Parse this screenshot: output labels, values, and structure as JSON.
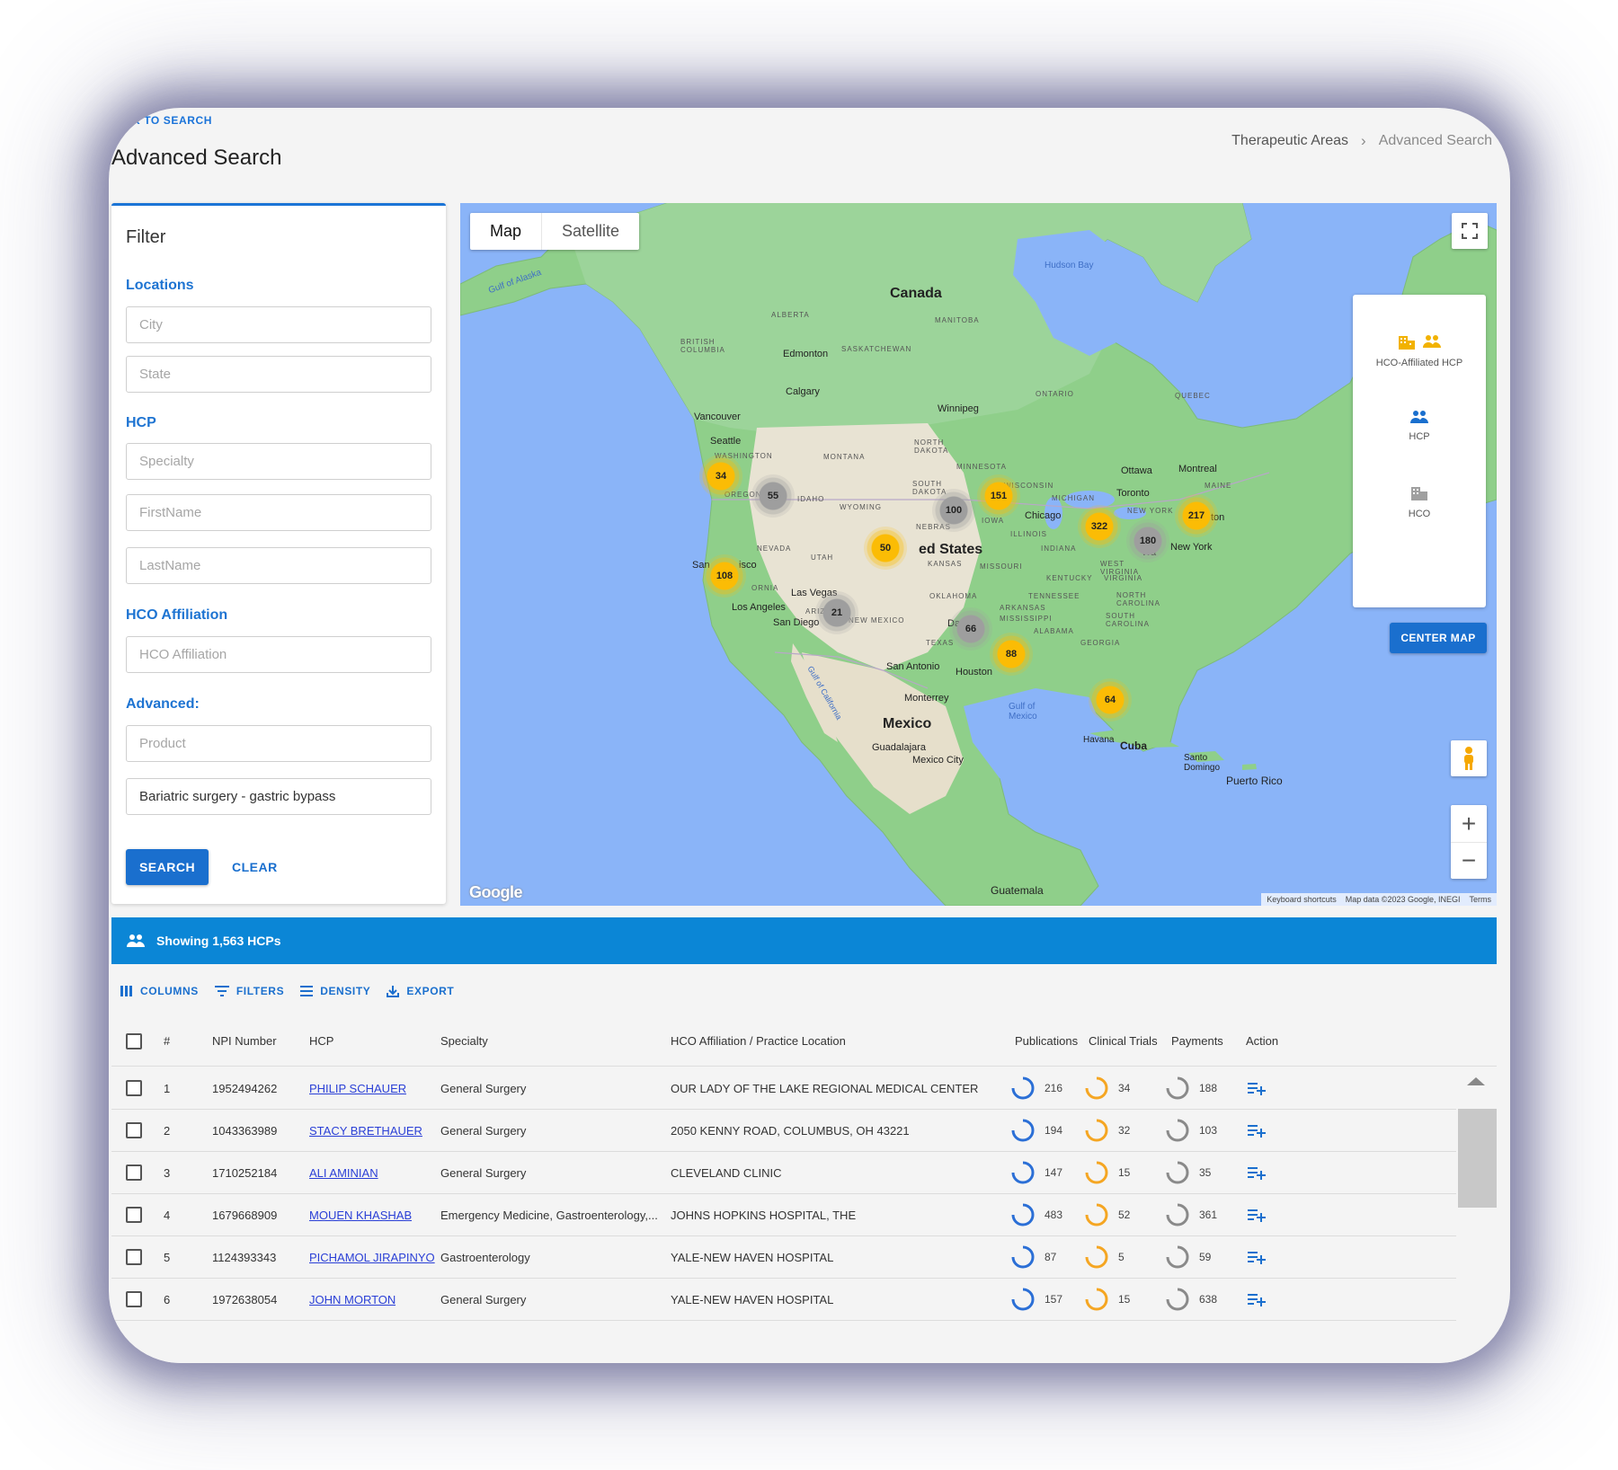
{
  "header": {
    "back_link": "K TO SEARCH",
    "title": "Advanced Search",
    "breadcrumb": [
      "Therapeutic Areas",
      "Advanced Search"
    ]
  },
  "filter": {
    "title": "Filter",
    "sections": {
      "locations": "Locations",
      "hcp": "HCP",
      "hco_affiliation": "HCO Affiliation",
      "advanced": "Advanced:"
    },
    "placeholders": {
      "city": "City",
      "state": "State",
      "specialty": "Specialty",
      "first_name": "FirstName",
      "last_name": "LastName",
      "hco_affiliation": "HCO Affiliation",
      "product": "Product"
    },
    "values": {
      "procedure": "Bariatric surgery - gastric bypass"
    },
    "search_label": "SEARCH",
    "clear_label": "CLEAR"
  },
  "map": {
    "tabs": [
      "Map",
      "Satellite"
    ],
    "legend": {
      "hco_affiliated_hcp": "HCO-Affiliated HCP",
      "hcp": "HCP",
      "hco": "HCO"
    },
    "center_map_label": "CENTER MAP",
    "credits": [
      "Keyboard shortcuts",
      "Map data ©2023 Google, INEGI",
      "Terms"
    ],
    "google_logo": "Google",
    "labels": {
      "canada": "Canada",
      "united_states": "ed States",
      "mexico": "Mexico",
      "cuba": "Cuba",
      "havana": "Havana",
      "guatemala": "Guatemala",
      "puerto_rico": "Puerto Rico",
      "santo_domingo": "Santo Domingo",
      "hudson_bay": "Hudson Bay",
      "gulf_of_alaska": "Gulf of Alaska",
      "gulf_of_mexico": "Gulf of Mexico",
      "gulf_of_california": "Gulf of California",
      "alberta": "ALBERTA",
      "manitoba": "MANITOBA",
      "british_columbia": "BRITISH COLUMBIA",
      "saskatchewan": "SASKATCHEWAN",
      "ontario": "ONTARIO",
      "quebec": "QUEBEC",
      "edmonton": "Edmonton",
      "calgary": "Calgary",
      "winnipeg": "Winnipeg",
      "vancouver": "Vancouver",
      "seattle": "Seattle",
      "washington": "WASHINGTON",
      "oregon": "OREGON",
      "idaho": "IDAHO",
      "montana": "MONTANA",
      "wyoming": "WYOMING",
      "north_dakota": "NORTH DAKOTA",
      "south_dakota": "SOUTH DAKOTA",
      "minnesota": "MINNESOTA",
      "wisconsin": "WISCONSIN",
      "michigan": "MICHIGAN",
      "iowa": "IOWA",
      "nebraska": "NEBRAS",
      "nevada": "NEVADA",
      "utah": "UTAH",
      "kansas": "KANSAS",
      "missouri": "MISSOURI",
      "illinois": "ILLINOIS",
      "indiana": "INDIANA",
      "kentucky": "KENTUCKY",
      "tennessee": "TENNESSEE",
      "oklahoma": "OKLAHOMA",
      "texas": "TEXAS",
      "arkansas": "ARKANSAS",
      "mississippi": "MISSISSIPPI",
      "alabama": "ALABAMA",
      "georgia": "GEORGIA",
      "new_mexico": "NEW MEXICO",
      "arizona": "ARIZ",
      "california": "ORNIA",
      "west_virginia": "WEST VIRGINIA",
      "virginia": "VIRGINIA",
      "north_carolina": "NORTH CAROLINA",
      "south_carolina": "SOUTH CAROLINA",
      "new_york_state": "NEW YORK",
      "maine": "MAINE",
      "ottawa": "Ottawa",
      "montreal": "Montreal",
      "toronto": "Toronto",
      "chicago": "Chicago",
      "new_york": "New York",
      "los_angeles": "Los Angeles",
      "san_diego": "San Diego",
      "las_vegas": "Las Vegas",
      "san_francisco": "San",
      "san_francisco_rest": "isco",
      "dallas": "Da",
      "houston": "Houston",
      "san_antonio": "San Antonio",
      "monterrey": "Monterrey",
      "guadalajara": "Guadalajara",
      "mexico_city": "Mexico City",
      "washington_dc": "Wa",
      "boston": "ton"
    },
    "clusters": [
      {
        "label": "34",
        "type": "yellow"
      },
      {
        "label": "55",
        "type": "gray"
      },
      {
        "label": "100",
        "type": "gray"
      },
      {
        "label": "151",
        "type": "yellow"
      },
      {
        "label": "322",
        "type": "yellow"
      },
      {
        "label": "180",
        "type": "gray"
      },
      {
        "label": "217",
        "type": "yellow"
      },
      {
        "label": "50",
        "type": "yellow"
      },
      {
        "label": "108",
        "type": "yellow"
      },
      {
        "label": "21",
        "type": "gray"
      },
      {
        "label": "66",
        "type": "gray"
      },
      {
        "label": "88",
        "type": "yellow"
      },
      {
        "label": "64",
        "type": "yellow"
      }
    ]
  },
  "results": {
    "showing_text": "Showing 1,563 HCPs"
  },
  "grid": {
    "toolbar": [
      "COLUMNS",
      "FILTERS",
      "DENSITY",
      "EXPORT"
    ],
    "columns": [
      "#",
      "NPI Number",
      "HCP",
      "Specialty",
      "HCO Affiliation / Practice Location",
      "Publications",
      "Clinical Trials",
      "Payments",
      "Action"
    ],
    "rows": [
      {
        "idx": "1",
        "npi": "1952494262",
        "hcp": "PHILIP SCHAUER",
        "specialty": "General Surgery",
        "hco": "OUR LADY OF THE LAKE REGIONAL MEDICAL CENTER",
        "publications": "216",
        "trials": "34",
        "payments": "188"
      },
      {
        "idx": "2",
        "npi": "1043363989",
        "hcp": "STACY BRETHAUER",
        "specialty": "General Surgery",
        "hco": "2050 KENNY ROAD, COLUMBUS, OH 43221",
        "publications": "194",
        "trials": "32",
        "payments": "103"
      },
      {
        "idx": "3",
        "npi": "1710252184",
        "hcp": "ALI AMINIAN",
        "specialty": "General Surgery",
        "hco": "CLEVELAND CLINIC",
        "publications": "147",
        "trials": "15",
        "payments": "35"
      },
      {
        "idx": "4",
        "npi": "1679668909",
        "hcp": "MOUEN KHASHAB",
        "specialty": "Emergency Medicine, Gastroenterology,...",
        "hco": "JOHNS HOPKINS HOSPITAL, THE",
        "publications": "483",
        "trials": "52",
        "payments": "361"
      },
      {
        "idx": "5",
        "npi": "1124393343",
        "hcp": "PICHAMOL JIRAPINYO",
        "specialty": "Gastroenterology",
        "hco": "YALE-NEW HAVEN HOSPITAL",
        "publications": "87",
        "trials": "5",
        "payments": "59"
      },
      {
        "idx": "6",
        "npi": "1972638054",
        "hcp": "JOHN MORTON",
        "specialty": "General Surgery",
        "hco": "YALE-NEW HAVEN HOSPITAL",
        "publications": "157",
        "trials": "15",
        "payments": "638"
      }
    ]
  },
  "colors": {
    "primary": "#1a6fce",
    "banner": "#0b86d6",
    "cluster_yellow": "#fbbc05",
    "cluster_gray": "#9e9e9e",
    "ring_publications": "#2b6fd6",
    "ring_trials": "#f5a623",
    "ring_payments": "#8a8a8a"
  }
}
